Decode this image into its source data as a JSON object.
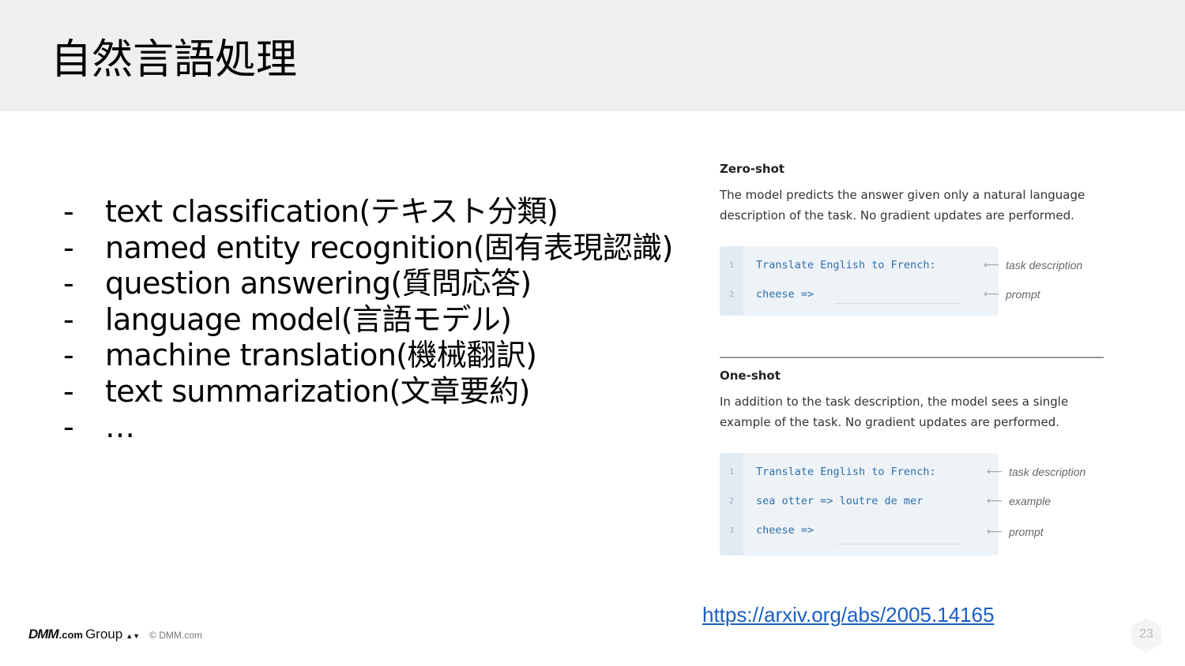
{
  "header": {
    "title": "自然言語処理"
  },
  "bullets": {
    "dash": "-",
    "items": [
      "text classification(テキスト分類)",
      "named entity recognition(固有表現認識)",
      "question answering(質問応答)",
      "language model(言語モデル)",
      "machine translation(機械翻訳)",
      "text summarization(文章要約)",
      "…"
    ]
  },
  "figure": {
    "zero_shot": {
      "heading": "Zero-shot",
      "desc_line1": "The model predicts the answer given only a natural language",
      "desc_line2": "description of the task. No gradient updates are performed.",
      "lines": [
        {
          "num": "1",
          "code": "Translate English to French:",
          "annotation": "task description"
        },
        {
          "num": "2",
          "code": "cheese =>",
          "annotation": "prompt"
        }
      ]
    },
    "one_shot": {
      "heading": "One-shot",
      "desc_line1": "In addition to the task description, the model sees a single",
      "desc_line2": "example of the task. No gradient updates are performed.",
      "lines": [
        {
          "num": "1",
          "code": "Translate English to French:",
          "annotation": "task description"
        },
        {
          "num": "2",
          "code": "sea otter => loutre de mer",
          "annotation": "example"
        },
        {
          "num": "3",
          "code": "cheese =>",
          "annotation": "prompt"
        }
      ]
    },
    "arrow": "⟵"
  },
  "link": {
    "text": "https://arxiv.org/abs/2005.14165"
  },
  "footer": {
    "logo_dmm": "DMM",
    "logo_com": ".com",
    "logo_group": "Group",
    "logo_mark": "▲▼",
    "copyright": "© DMM.com",
    "page_number": "23"
  },
  "colors": {
    "header_bg": "#efefef",
    "code_text": "#2f6fa8",
    "code_bg": "#eef3f8",
    "link": "#1a5fc4"
  }
}
